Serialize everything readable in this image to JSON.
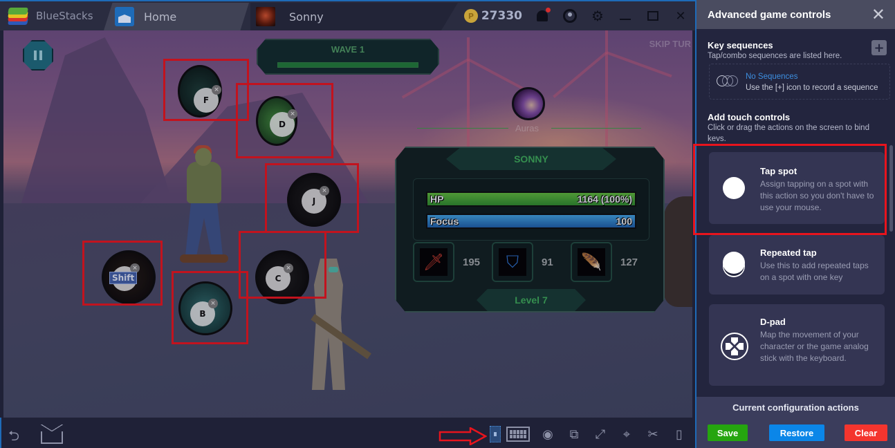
{
  "titlebar": {
    "brand": "BlueStacks",
    "tabs": [
      {
        "label": "Home",
        "icon": "home-icon"
      },
      {
        "label": "Sonny",
        "icon": "game-thumbnail"
      }
    ],
    "coins": "27330",
    "coin_symbol": "P",
    "icons": [
      "coin-icon",
      "bell-icon",
      "account-icon",
      "gear-icon",
      "minimize-icon",
      "maximize-icon",
      "close-icon"
    ]
  },
  "game": {
    "wave_label": "WAVE 1",
    "wave_progress": 1.0,
    "skip_label": "SKIP TUR",
    "auras_label": "Auras",
    "character": {
      "name": "SONNY",
      "hp_label": "HP",
      "hp_value": "1164 (100%)",
      "hp_fraction": 1.0,
      "focus_label": "Focus",
      "focus_value": "100",
      "focus_fraction": 1.0,
      "stats": [
        {
          "icon": "sword-icon",
          "value": "195"
        },
        {
          "icon": "shield-icon",
          "value": "91"
        },
        {
          "icon": "feather-icon",
          "value": "127"
        }
      ],
      "level": "Level 7"
    },
    "key_controls": [
      {
        "key": "F"
      },
      {
        "key": "D"
      },
      {
        "key": "J"
      },
      {
        "key": "Shift"
      },
      {
        "key": "C"
      },
      {
        "key": "B"
      }
    ],
    "remove_symbol": "×"
  },
  "bottombar": {
    "back_symbol": "⮌",
    "icons": [
      "back-icon",
      "home-icon",
      "lock-icon",
      "keyboard-icon",
      "eye-icon",
      "rotate-icon",
      "fullscreen-icon",
      "location-icon",
      "scissors-icon",
      "shake-icon"
    ]
  },
  "sidebar": {
    "title": "Advanced game controls",
    "close_symbol": "✕",
    "key_sequences": {
      "title": "Key sequences",
      "subtitle": "Tap/combo sequences are listed here.",
      "plus_symbol": "+",
      "empty_title": "No Sequences",
      "empty_sub": "Use the [+] icon to record a sequence"
    },
    "touch_controls": {
      "title": "Add touch controls",
      "subtitle": "Click or drag the actions on the screen to bind keys."
    },
    "cards": [
      {
        "title": "Tap spot",
        "desc": "Assign tapping on a spot with this action so you don't have to use your mouse.",
        "icon": "tap-spot-icon"
      },
      {
        "title": "Repeated tap",
        "desc": "Use this to add repeated taps on a spot with one key",
        "icon": "repeated-tap-icon"
      },
      {
        "title": "D-pad",
        "desc": "Map the movement of your character or the game analog stick with the keyboard.",
        "icon": "dpad-icon"
      }
    ],
    "footer": {
      "title": "Current configuration actions",
      "save": "Save",
      "restore": "Restore",
      "clear": "Clear"
    },
    "colors": {
      "save": "#25a50f",
      "restore": "#0b86e8",
      "clear": "#f4352e",
      "link": "#3d8fe0",
      "highlight": "#e8141d"
    }
  }
}
